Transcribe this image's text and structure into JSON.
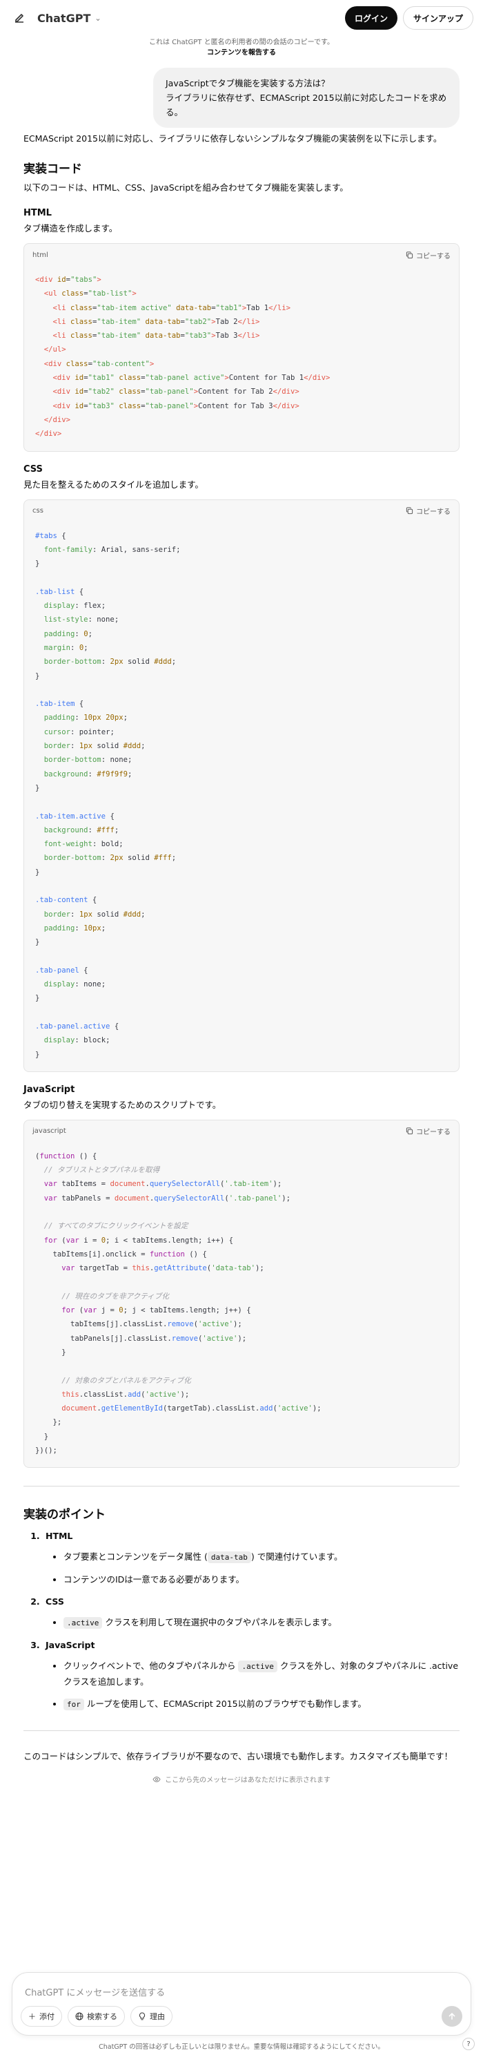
{
  "header": {
    "brand": "ChatGPT",
    "login": "ログイン",
    "signup": "サインアップ"
  },
  "shared_note": {
    "text": "これは ChatGPT と匿名の利用者の間の会話のコピーです。",
    "report": "コンテンツを報告する"
  },
  "user_message": {
    "line1": "JavaScriptでタブ機能を実装する方法は？",
    "line2": "ライブラリに依存せず、ECMAScript 2015以前に対応したコードを求める。"
  },
  "answer": {
    "intro": "ECMAScript 2015以前に対応し、ライブラリに依存しないシンプルなタブ機能の実装例を以下に示します。",
    "h_code": "実装コード",
    "code_intro": "以下のコードは、HTML、CSS、JavaScriptを組み合わせてタブ機能を実装します。",
    "html": {
      "title": "HTML",
      "desc": "タブ構造を作成します。",
      "lang": "html"
    },
    "css": {
      "title": "CSS",
      "desc": "見た目を整えるためのスタイルを追加します。",
      "lang": "css"
    },
    "js": {
      "title": "JavaScript",
      "desc": "タブの切り替えを実現するためのスクリプトです。",
      "lang": "javascript"
    },
    "copy_label": "コピーする",
    "h_points": "実装のポイント",
    "points": [
      {
        "title": "HTML",
        "bullets": [
          {
            "pre": "タブ要素とコンテンツをデータ属性 (",
            "code": "data-tab",
            "post": ") で関連付けています。"
          },
          {
            "pre": "コンテンツのIDは一意である必要があります。",
            "code": "",
            "post": ""
          }
        ]
      },
      {
        "title": "CSS",
        "bullets": [
          {
            "pre": "",
            "code": ".active",
            "post": " クラスを利用して現在選択中のタブやパネルを表示します。"
          }
        ]
      },
      {
        "title": "JavaScript",
        "bullets": [
          {
            "pre": "クリックイベントで、他のタブやパネルから ",
            "code": ".active",
            "post": " クラスを外し、対象のタブやパネルに .active クラスを追加します。"
          },
          {
            "pre": "",
            "code": "for",
            "post": " ループを使用して、ECMAScript 2015以前のブラウザでも動作します。"
          }
        ]
      }
    ],
    "closing": "このコードはシンプルで、依存ライブラリが不要なので、古い環境でも動作します。カスタマイズも簡単です！",
    "below_note": "ここから先のメッセージはあなただけに表示されます"
  },
  "composer": {
    "placeholder": "ChatGPT にメッセージを送信する",
    "attach": "添付",
    "search": "検索する",
    "reason": "理由"
  },
  "disclaimer": "ChatGPT の回答は必ずしも正しいとは限りません。重要な情報は確認するようにしてください。",
  "help": "?"
}
